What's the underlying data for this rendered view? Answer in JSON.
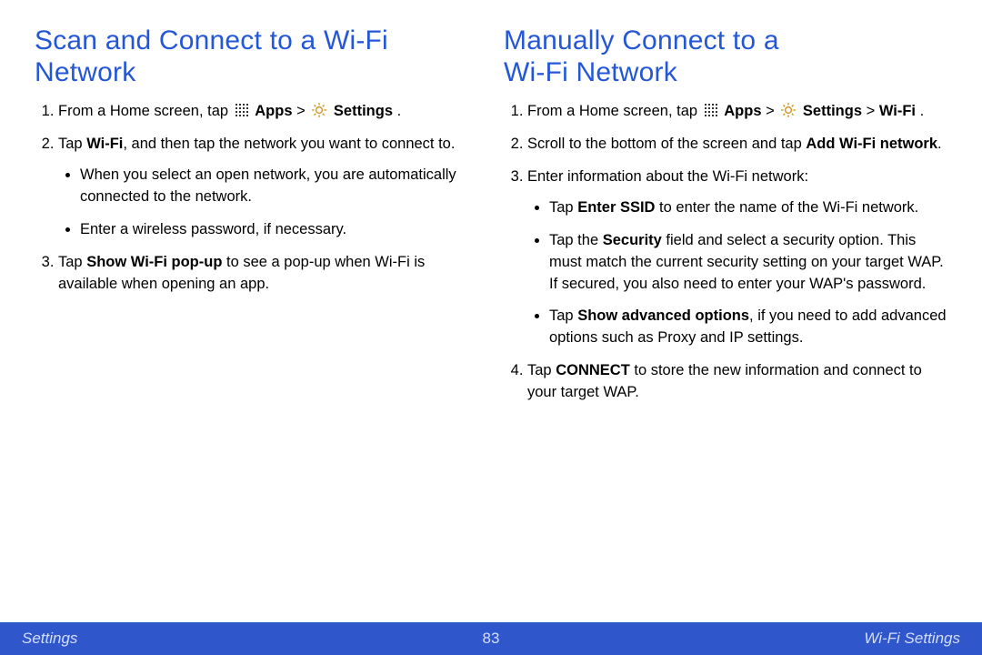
{
  "footer": {
    "left": "Settings",
    "center": "83",
    "right": "Wi-Fi Settings"
  },
  "left": {
    "heading": "Scan and Connect to a Wi-Fi Network",
    "steps": {
      "s1": {
        "pre": "From a Home screen, tap ",
        "apps": "Apps",
        "gt": " > ",
        "settings": "Settings",
        "post": "."
      },
      "s2": {
        "a": "Tap ",
        "b": "Wi-Fi",
        "c": ", and then tap the network you want to connect to."
      },
      "s2_bullets": {
        "b1": "When you select an open network, you are automatically connected to the network.",
        "b2": "Enter a wireless password, if necessary."
      },
      "s3": {
        "a": "Tap ",
        "b": "Show Wi-Fi pop-up",
        "c": " to see a pop-up when Wi-Fi is available when opening an app."
      }
    }
  },
  "right": {
    "heading": "Manually Connect to a Wi‑Fi Network",
    "steps": {
      "s1": {
        "pre": "From a Home screen, tap ",
        "apps": "Apps",
        "gt": " > ",
        "settings": "Settings",
        "gt2": " > ",
        "wifi": "Wi-Fi",
        "post": "."
      },
      "s2": {
        "a": "Scroll to the bottom of the screen and tap ",
        "b": "Add Wi-Fi network",
        "c": "."
      },
      "s3": "Enter information about the Wi-Fi network:",
      "s3_bullets": {
        "b1": {
          "a": "Tap ",
          "b": "Enter SSID",
          "c": " to enter the name of the Wi-Fi network."
        },
        "b2": {
          "a": "Tap the ",
          "b": "Security",
          "c": " field and select a security option. This must match the current security setting on your target WAP. If secured, you also need to enter your WAP's password."
        },
        "b3": {
          "a": "Tap ",
          "b": "Show advanced options",
          "c": ", if you need to add advanced options such as Proxy and IP settings."
        }
      },
      "s4": {
        "a": "Tap ",
        "b": "CONNECT",
        "c": " to store the new information and connect to your target WAP."
      }
    }
  }
}
